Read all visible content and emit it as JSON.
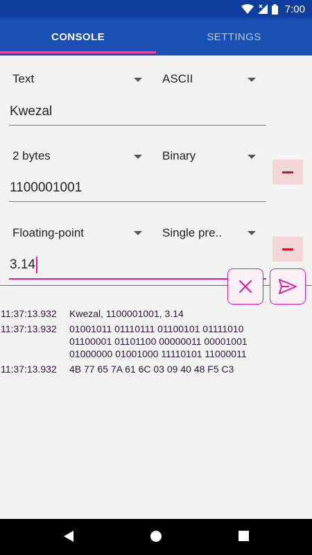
{
  "status_bar": {
    "time": "7:00",
    "icons": [
      "wifi-icon",
      "signal-icon",
      "battery-icon"
    ]
  },
  "tabs": [
    {
      "label": "CONSOLE",
      "active": true
    },
    {
      "label": "SETTINGS",
      "active": false
    }
  ],
  "rows": [
    {
      "type": "Text",
      "encoding": "ASCII",
      "value": "Kwezal",
      "removable": false
    },
    {
      "type": "2 bytes",
      "encoding": "Binary",
      "value": "1100001001",
      "removable": true
    },
    {
      "type": "Floating-point",
      "encoding": "Single pre..",
      "value": "3.14",
      "removable": true,
      "focused": true
    }
  ],
  "console": [
    {
      "time": "11:37:13.932",
      "message": "Kwezal, 1100001001, 3.14"
    },
    {
      "time": "11:37:13.932",
      "message": "01001011 01110111 01100101 01111010 01100001 01101100 00000011 00001001 01000000 01001000 11110101 11000011"
    },
    {
      "time": "11:37:13.932",
      "message": "4B 77 65 7A 61 6C 03 09 40 48 F5 C3"
    }
  ],
  "colors": {
    "primary": "#1a4fb4",
    "status_bar": "#0e3fa0",
    "accent": "#e01c9a",
    "remove_bg": "#f3d6d8",
    "remove_fg": "#c7142c"
  }
}
